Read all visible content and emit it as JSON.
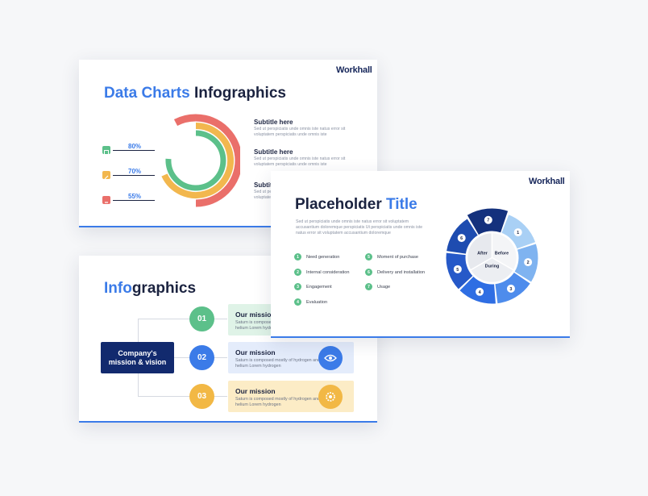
{
  "slide1": {
    "brand": "Workhall",
    "title_accent": "Data Charts",
    "title_rest": "Infographics",
    "percents": [
      "80%",
      "70%",
      "55%"
    ],
    "subtitles": [
      {
        "title": "Subtitle here",
        "desc": "Sed ut perspiciatis unde omnis iste natus error sit voluptatem perspiciatis unde omnis iste"
      },
      {
        "title": "Subtitle here",
        "desc": "Sed ut perspiciatis unde omnis iste natus error sit voluptatem perspiciatis unde omnis iste"
      },
      {
        "title": "Subtit",
        "desc": "Sed ut per voluptatem"
      }
    ],
    "colors": {
      "ring_outer": "#ea6f6a",
      "ring_mid": "#f2b74e",
      "ring_inner": "#5cc08a"
    }
  },
  "slide2": {
    "title_accent": "Info",
    "title_rest": "graphics",
    "company_label": "Company's mission & vision",
    "missions": [
      {
        "num": "01",
        "title": "Our mission",
        "desc": "Saturn is composed mostly of hydrogen and helium Lorem hydrogen",
        "color": "#5cc08a",
        "bg": "#dff3e7"
      },
      {
        "num": "02",
        "title": "Our mission",
        "desc": "Saturn is composed mostly of hydrogen and helium Lorem hydrogen",
        "color": "#3b7be8",
        "bg": "#e4ecfb"
      },
      {
        "num": "03",
        "title": "Our mission",
        "desc": "Saturn is composed mostly of hydrogen and helium Lorem hydrogen",
        "color": "#f2b845",
        "bg": "#fcecc6"
      }
    ]
  },
  "slide3": {
    "brand": "Workhall",
    "title_rest": "Placeholder",
    "title_accent": "Title",
    "description": "Sed ut perspiciatis unde omnis iste natus error sit voluptatem accusantium doloremque perspiciatis Ut perspiciatis unde omnis iste natus error sit voluptatem accusantium doloremque",
    "list_left": [
      {
        "num": "1",
        "label": "Need generation"
      },
      {
        "num": "2",
        "label": "Internal consideration"
      },
      {
        "num": "3",
        "label": "Engagement"
      },
      {
        "num": "4",
        "label": "Evaluation"
      }
    ],
    "list_right": [
      {
        "num": "5",
        "label": "Moment of purchase"
      },
      {
        "num": "6",
        "label": "Delivery and installation"
      },
      {
        "num": "7",
        "label": "Usage"
      }
    ],
    "wheel": {
      "inner": [
        "After",
        "Before",
        "During"
      ],
      "segments": [
        "1",
        "2",
        "3",
        "4",
        "5",
        "6",
        "7"
      ]
    }
  }
}
